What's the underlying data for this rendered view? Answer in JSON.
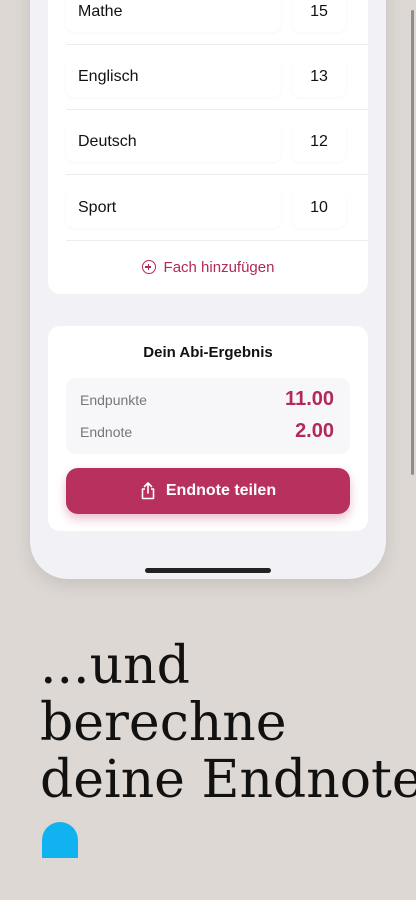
{
  "subjects": [
    {
      "name": "Mathe",
      "grade": "15"
    },
    {
      "name": "Englisch",
      "grade": "13"
    },
    {
      "name": "Deutsch",
      "grade": "12"
    },
    {
      "name": "Sport",
      "grade": "10"
    }
  ],
  "add_subject_label": "Fach hinzufügen",
  "result": {
    "title": "Dein Abi-Ergebnis",
    "points_label": "Endpunkte",
    "points_value": "11.00",
    "grade_label": "Endnote",
    "grade_value": "2.00",
    "share_label": "Endnote teilen"
  },
  "headline": [
    "...und",
    "berechne",
    "deine Endnote"
  ],
  "colors": {
    "accent": "#b8305d",
    "background": "#ddd8d4",
    "logo": "#10b2f0"
  },
  "icons": {
    "add": "plus-circle-icon",
    "share": "share-icon",
    "logo": "app-logo"
  }
}
